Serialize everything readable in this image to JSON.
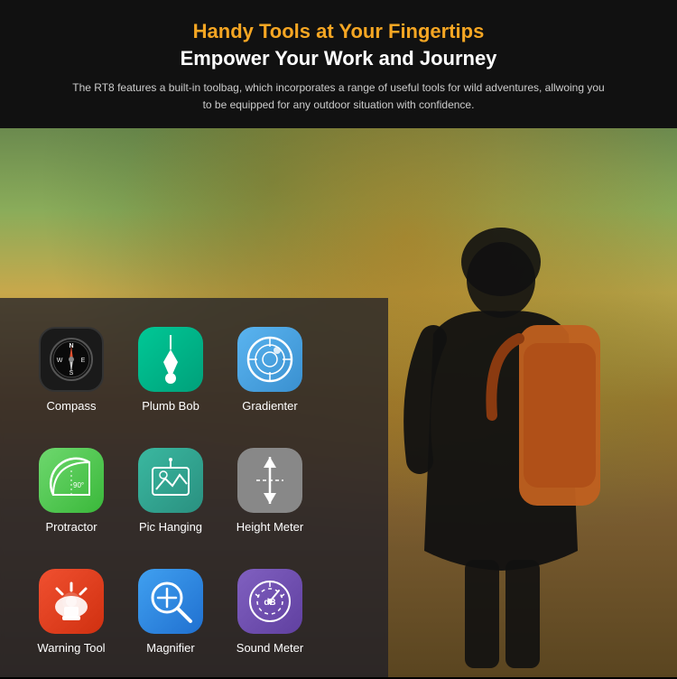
{
  "header": {
    "title_yellow": "Handy Tools at Your Fingertips",
    "title_white": "Empower Your Work and Journey",
    "description": "The RT8 features a built-in toolbag, which incorporates a range of useful tools for wild adventures, allwoing you to be equipped for any outdoor situation with confidence."
  },
  "tools": [
    {
      "id": "compass",
      "label": "Compass",
      "icon_type": "compass"
    },
    {
      "id": "plumb-bob",
      "label": "Plumb Bob",
      "icon_type": "plumb"
    },
    {
      "id": "gradienter",
      "label": "Gradienter",
      "icon_type": "gradienter"
    },
    {
      "id": "protractor",
      "label": "Protractor",
      "icon_type": "protractor"
    },
    {
      "id": "pic-hanging",
      "label": "Pic Hanging",
      "icon_type": "pic-hanging"
    },
    {
      "id": "height-meter",
      "label": "Height Meter",
      "icon_type": "height"
    },
    {
      "id": "warning-tool",
      "label": "Warning Tool",
      "icon_type": "warning"
    },
    {
      "id": "magnifier",
      "label": "Magnifier",
      "icon_type": "magnifier"
    },
    {
      "id": "sound-meter",
      "label": "Sound Meter",
      "icon_type": "sound"
    }
  ]
}
